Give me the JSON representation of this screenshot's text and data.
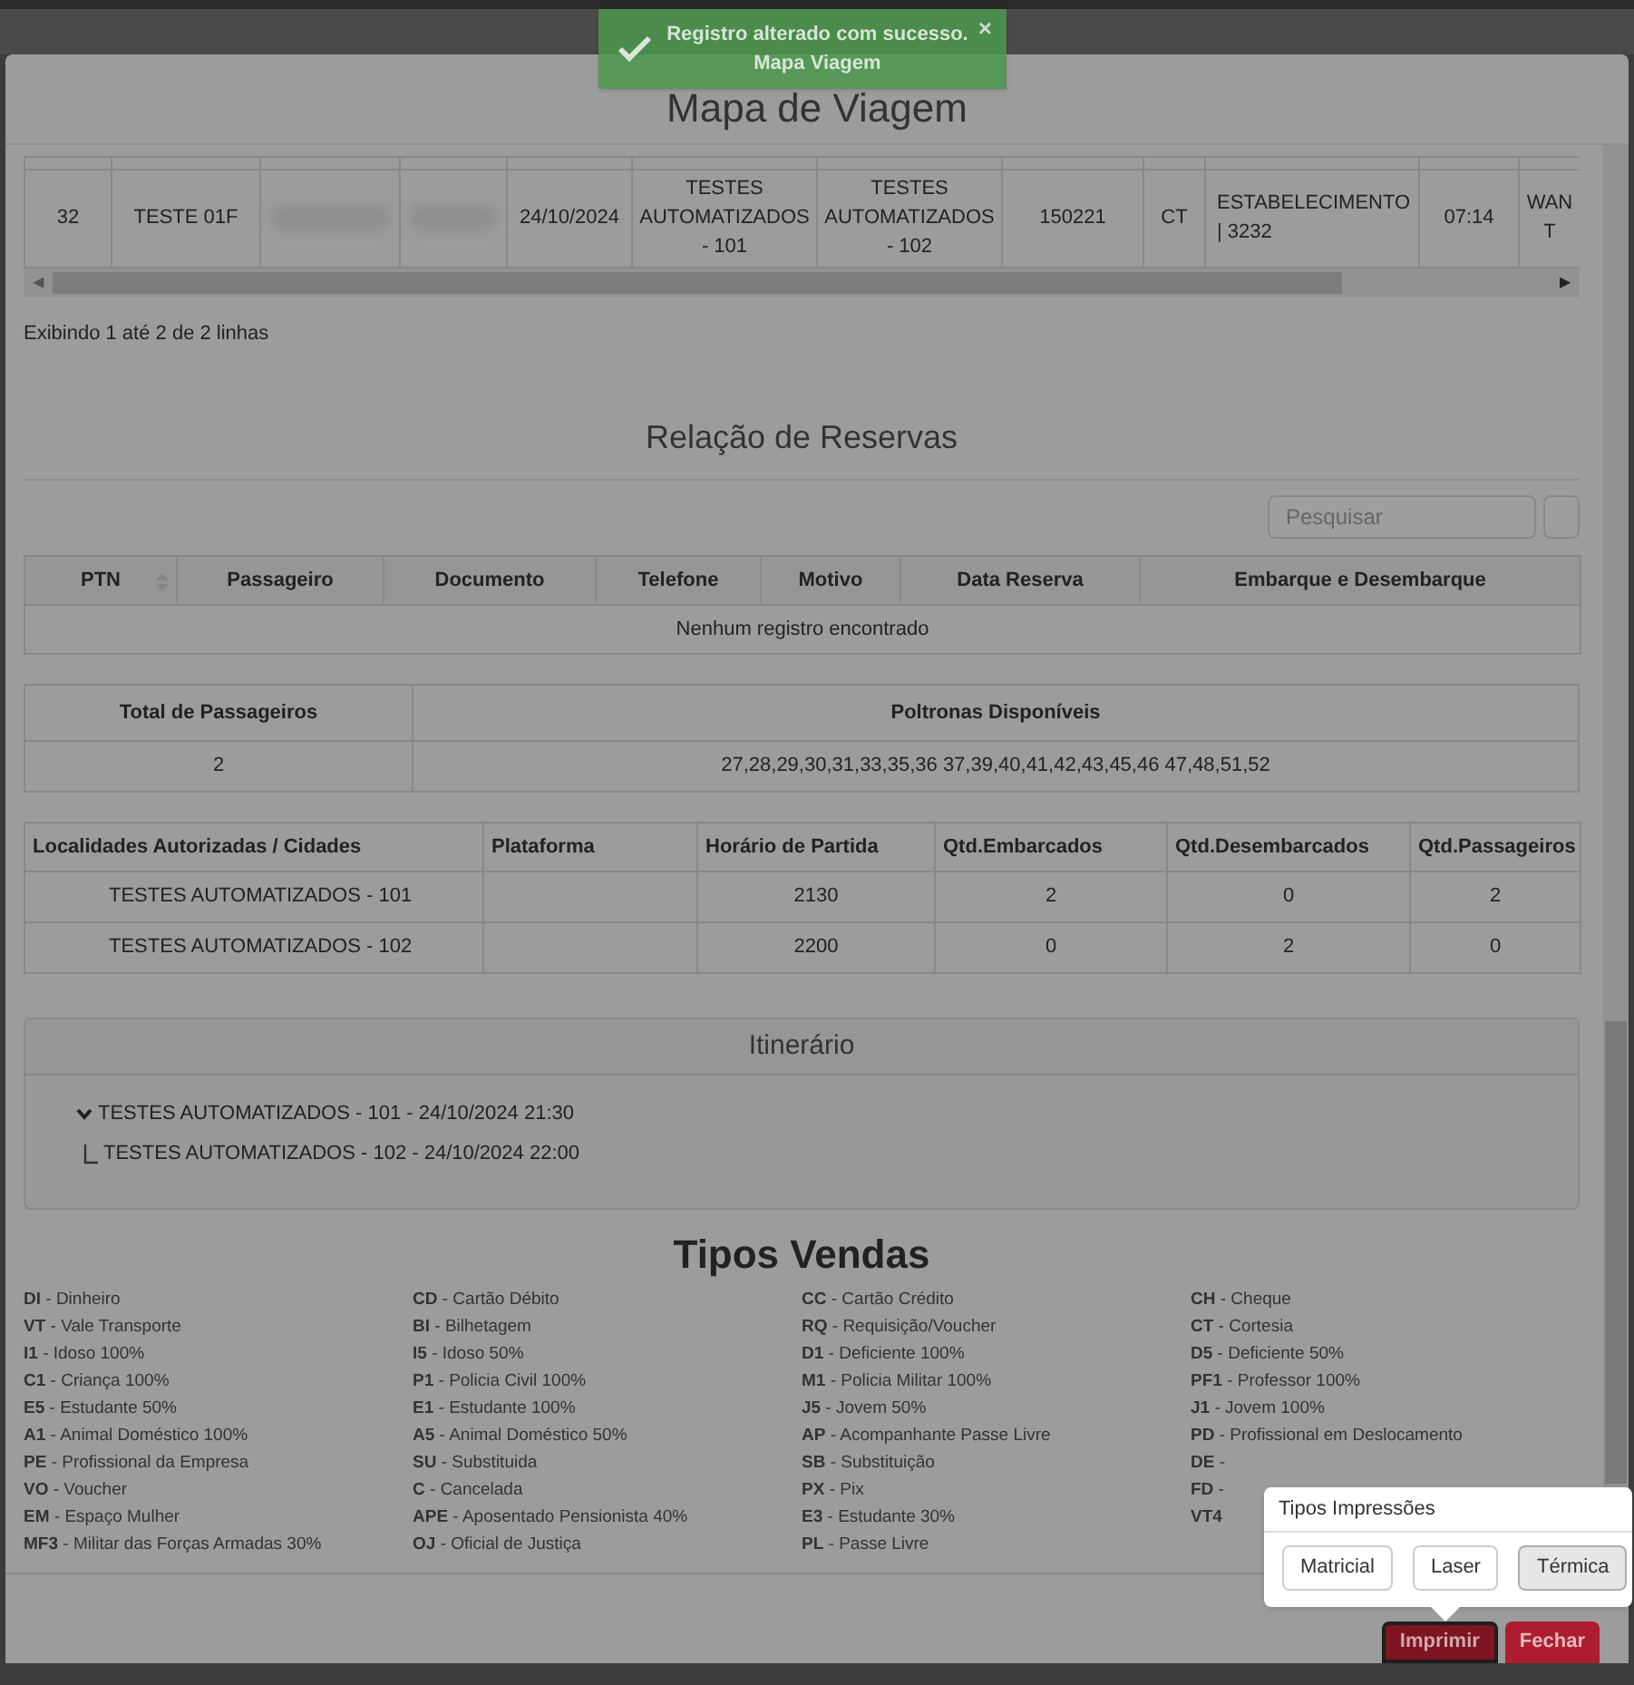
{
  "toast": {
    "message": "Registro alterado com sucesso.",
    "subtitle": "Mapa Viagem",
    "close": "×"
  },
  "modal": {
    "title": "Mapa de Viagem"
  },
  "trip_table": {
    "rows": [
      [
        {
          "kind": "text",
          "text": "32"
        },
        {
          "kind": "text",
          "text": "TESTE 01F"
        },
        {
          "kind": "redacted"
        },
        {
          "kind": "redacted"
        },
        {
          "kind": "text",
          "text": "24/10/2024"
        },
        {
          "kind": "text",
          "text": "TESTES AUTOMATIZADOS - 101"
        },
        {
          "kind": "text",
          "text": "TESTES AUTOMATIZADOS - 102"
        },
        {
          "kind": "text",
          "text": "150221"
        },
        {
          "kind": "text",
          "text": "CT"
        },
        {
          "kind": "left",
          "text": "ESTABELECIMENTO | 3232"
        },
        {
          "kind": "text",
          "text": "07:14"
        },
        {
          "kind": "text",
          "text": "WAN T"
        }
      ]
    ],
    "scroll_left": "◀",
    "scroll_right": "▶",
    "summary": "Exibindo 1 até 2 de 2 linhas"
  },
  "reservations": {
    "title": "Relação de Reservas",
    "search_placeholder": "Pesquisar",
    "columns": [
      "PTN",
      "Passageiro",
      "Documento",
      "Telefone",
      "Motivo",
      "Data Reserva",
      "Embarque e Desembarque"
    ],
    "empty_message": "Nenhum registro encontrado"
  },
  "totals": {
    "columns": [
      "Total de Passageiros",
      "Poltronas Disponíveis"
    ],
    "values": [
      "2",
      "27,28,29,30,31,33,35,36 37,39,40,41,42,43,45,46 47,48,51,52"
    ]
  },
  "localities": {
    "columns": [
      "Localidades Autorizadas / Cidades",
      "Plataforma",
      "Horário de Partida",
      "Qtd.Embarcados",
      "Qtd.Desembarcados",
      "Qtd.Passageiros"
    ],
    "rows": [
      [
        "TESTES AUTOMATIZADOS - 101",
        "",
        "2130",
        "2",
        "0",
        "2"
      ],
      [
        "TESTES AUTOMATIZADOS - 102",
        "",
        "2200",
        "0",
        "2",
        "0"
      ]
    ]
  },
  "itinerary": {
    "title": "Itinerário",
    "items": [
      {
        "label": "TESTES AUTOMATIZADOS - 101 - 24/10/2024 21:30",
        "expanded": true,
        "children": [
          {
            "label": "TESTES AUTOMATIZADOS - 102 - 24/10/2024 22:00"
          }
        ]
      }
    ]
  },
  "sales_types": {
    "title": "Tipos Vendas",
    "columns": [
      [
        {
          "code": "DI",
          "text": "- Dinheiro"
        },
        {
          "code": "VT",
          "text": "- Vale Transporte"
        },
        {
          "code": "I1",
          "text": "- Idoso 100%"
        },
        {
          "code": "C1",
          "text": "- Criança 100%"
        },
        {
          "code": "E5",
          "text": "- Estudante 50%"
        },
        {
          "code": "A1",
          "text": "- Animal Doméstico 100%"
        },
        {
          "code": "PE",
          "text": "- Profissional da Empresa"
        },
        {
          "code": "VO",
          "text": "- Voucher"
        },
        {
          "code": "EM",
          "text": "- Espaço Mulher"
        },
        {
          "code": "MF3",
          "text": "- Militar das Forças Armadas 30%"
        }
      ],
      [
        {
          "code": "CD",
          "text": "- Cartão Débito"
        },
        {
          "code": "BI",
          "text": "- Bilhetagem"
        },
        {
          "code": "I5",
          "text": "- Idoso 50%"
        },
        {
          "code": "P1",
          "text": "- Policia Civil 100%"
        },
        {
          "code": "E1",
          "text": "- Estudante 100%"
        },
        {
          "code": "A5",
          "text": "- Animal Doméstico 50%"
        },
        {
          "code": "SU",
          "text": "- Substituida"
        },
        {
          "code": "C",
          "text": "- Cancelada"
        },
        {
          "code": "APE",
          "text": "- Aposentado Pensionista 40%"
        },
        {
          "code": "OJ",
          "text": "- Oficial de Justiça"
        }
      ],
      [
        {
          "code": "CC",
          "text": "- Cartão Crédito"
        },
        {
          "code": "RQ",
          "text": "- Requisição/Voucher"
        },
        {
          "code": "D1",
          "text": "- Deficiente 100%"
        },
        {
          "code": "M1",
          "text": "- Policia Militar 100%"
        },
        {
          "code": "J5",
          "text": "- Jovem 50%"
        },
        {
          "code": "AP",
          "text": "- Acompanhante Passe Livre"
        },
        {
          "code": "SB",
          "text": "- Substituição"
        },
        {
          "code": "PX",
          "text": "- Pix"
        },
        {
          "code": "E3",
          "text": "- Estudante 30%"
        },
        {
          "code": "PL",
          "text": "- Passe Livre"
        }
      ],
      [
        {
          "code": "CH",
          "text": "- Cheque"
        },
        {
          "code": "CT",
          "text": "- Cortesia"
        },
        {
          "code": "D5",
          "text": "- Deficiente 50%"
        },
        {
          "code": "PF1",
          "text": "- Professor 100%"
        },
        {
          "code": "J1",
          "text": "- Jovem 100%"
        },
        {
          "code": "PD",
          "text": "- Profissional em Deslocamento"
        },
        {
          "code": "DE",
          "text": "-"
        },
        {
          "code": "FD",
          "text": "-"
        },
        {
          "code": "VT4",
          "text": ""
        }
      ]
    ]
  },
  "print_popover": {
    "title": "Tipos Impressões",
    "options": [
      {
        "label": "Matricial",
        "selected": false
      },
      {
        "label": "Laser",
        "selected": false
      },
      {
        "label": "Térmica",
        "selected": true
      }
    ]
  },
  "footer_buttons": [
    {
      "label": "Imprimir",
      "kind": "print",
      "pressed": true
    },
    {
      "label": "Fechar",
      "kind": "close",
      "pressed": false
    }
  ]
}
